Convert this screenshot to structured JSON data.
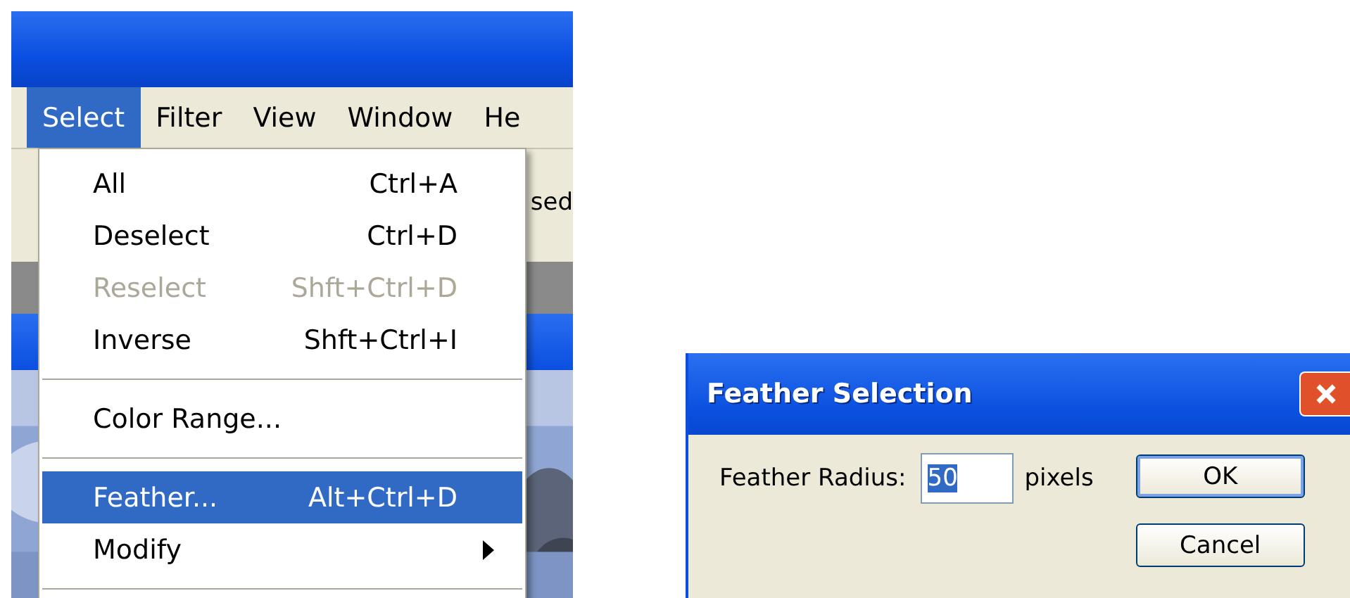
{
  "app": {
    "menubar": [
      {
        "label": "Select",
        "selected": true
      },
      {
        "label": "Filter",
        "selected": false
      },
      {
        "label": "View",
        "selected": false
      },
      {
        "label": "Window",
        "selected": false
      },
      {
        "label": "He",
        "selected": false
      }
    ],
    "toolbar_text": "sed",
    "menu": [
      {
        "kind": "item",
        "label": "All",
        "shortcut": "Ctrl+A",
        "disabled": false,
        "selected": false
      },
      {
        "kind": "item",
        "label": "Deselect",
        "shortcut": "Ctrl+D",
        "disabled": false,
        "selected": false
      },
      {
        "kind": "item",
        "label": "Reselect",
        "shortcut": "Shft+Ctrl+D",
        "disabled": true,
        "selected": false
      },
      {
        "kind": "item",
        "label": "Inverse",
        "shortcut": "Shft+Ctrl+I",
        "disabled": false,
        "selected": false
      },
      {
        "kind": "separator"
      },
      {
        "kind": "item",
        "label": "Color Range...",
        "disabled": false,
        "selected": false
      },
      {
        "kind": "separator"
      },
      {
        "kind": "item",
        "label": "Feather...",
        "shortcut": "Alt+Ctrl+D",
        "disabled": false,
        "selected": true
      },
      {
        "kind": "submenu",
        "label": "Modify",
        "disabled": false,
        "selected": false
      },
      {
        "kind": "separator"
      }
    ]
  },
  "dialog": {
    "title": "Feather Selection",
    "field_label": "Feather Radius:",
    "field_value": "50",
    "unit": "pixels",
    "buttons": [
      "OK",
      "Cancel"
    ]
  }
}
